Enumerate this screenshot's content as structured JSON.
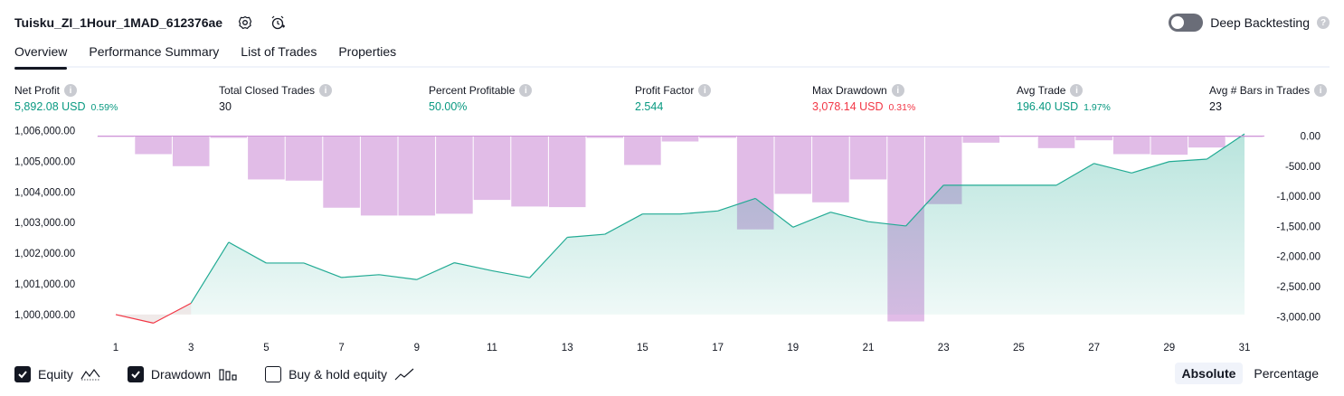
{
  "header": {
    "title": "Tuisku_ZI_1Hour_1MAD_612376ae",
    "settings_icon": "gear-icon",
    "alert_icon": "alarm-add-icon",
    "deep_backtesting_label": "Deep Backtesting",
    "deep_backtesting_enabled": false
  },
  "tabs": [
    {
      "label": "Overview",
      "active": true
    },
    {
      "label": "Performance Summary",
      "active": false
    },
    {
      "label": "List of Trades",
      "active": false
    },
    {
      "label": "Properties",
      "active": false
    }
  ],
  "metrics": [
    {
      "label": "Net Profit",
      "value": "5,892.08 USD",
      "pct": "0.59%",
      "tone": "pos"
    },
    {
      "label": "Total Closed Trades",
      "value": "30",
      "pct": "",
      "tone": "neutral"
    },
    {
      "label": "Percent Profitable",
      "value": "50.00%",
      "pct": "",
      "tone": "pos"
    },
    {
      "label": "Profit Factor",
      "value": "2.544",
      "pct": "",
      "tone": "pos"
    },
    {
      "label": "Max Drawdown",
      "value": "3,078.14 USD",
      "pct": "0.31%",
      "tone": "neg"
    },
    {
      "label": "Avg Trade",
      "value": "196.40 USD",
      "pct": "1.97%",
      "tone": "pos"
    },
    {
      "label": "Avg # Bars in Trades",
      "value": "23",
      "pct": "",
      "tone": "neutral"
    }
  ],
  "colors": {
    "equity_line": "#22ab94",
    "equity_fill": "#22ab94",
    "equity_negative": "#f23645",
    "drawdown_bar": "#ce93d8",
    "positive_text": "#089981",
    "negative_text": "#f23645"
  },
  "chart_data": {
    "type": "line",
    "x_label": "",
    "x_ticks": [
      "1",
      "3",
      "5",
      "7",
      "9",
      "11",
      "13",
      "15",
      "17",
      "19",
      "21",
      "23",
      "25",
      "27",
      "29",
      "31"
    ],
    "left_axis": {
      "ticks": [
        "1,006,000.00",
        "1,005,000.00",
        "1,004,000.00",
        "1,003,000.00",
        "1,002,000.00",
        "1,001,000.00",
        "1,000,000.00"
      ],
      "range": [
        999500,
        1006300
      ]
    },
    "right_axis": {
      "ticks": [
        "0.00",
        "-500.00",
        "-1,000.00",
        "-1,500.00",
        "-2,000.00",
        "-2,500.00",
        "-3,000.00"
      ],
      "range": [
        -3150,
        0
      ]
    },
    "series": [
      {
        "name": "Equity",
        "kind": "area",
        "x": [
          1,
          2,
          3,
          4,
          5,
          6,
          7,
          8,
          9,
          10,
          11,
          12,
          13,
          14,
          15,
          16,
          17,
          18,
          19,
          20,
          21,
          22,
          23,
          24,
          25,
          26,
          27,
          28,
          29,
          30,
          31
        ],
        "values": [
          1000000,
          999720,
          1000370,
          1002360,
          1001680,
          1001680,
          1001210,
          1001300,
          1001140,
          1001690,
          1001430,
          1001200,
          1002520,
          1002620,
          1003280,
          1003280,
          1003380,
          1003790,
          1002850,
          1003340,
          1003030,
          1002890,
          1004220,
          1004220,
          1004220,
          1004220,
          1004930,
          1004620,
          1004990,
          1005070,
          1005892
        ]
      },
      {
        "name": "Drawdown",
        "kind": "bar",
        "x": [
          1,
          2,
          3,
          4,
          5,
          6,
          7,
          8,
          9,
          10,
          11,
          12,
          13,
          14,
          15,
          16,
          17,
          18,
          19,
          20,
          21,
          22,
          23,
          24,
          25,
          26,
          27,
          28,
          29,
          30,
          31
        ],
        "values": [
          -10,
          -300,
          -500,
          -30,
          -720,
          -740,
          -1190,
          -1320,
          -1320,
          -1290,
          -1060,
          -1170,
          -1180,
          -30,
          -480,
          -90,
          -30,
          -1550,
          -960,
          -1100,
          -720,
          -3078,
          -1130,
          -110,
          -10,
          -200,
          -70,
          -300,
          -310,
          -190,
          -10
        ]
      }
    ]
  },
  "legend": [
    {
      "label": "Equity",
      "checked": true,
      "icon": "equity-line-icon"
    },
    {
      "label": "Drawdown",
      "checked": true,
      "icon": "drawdown-bars-icon"
    },
    {
      "label": "Buy & hold equity",
      "checked": false,
      "icon": "buy-hold-line-icon"
    }
  ],
  "mode": {
    "options": [
      "Absolute",
      "Percentage"
    ],
    "selected": "Absolute"
  }
}
